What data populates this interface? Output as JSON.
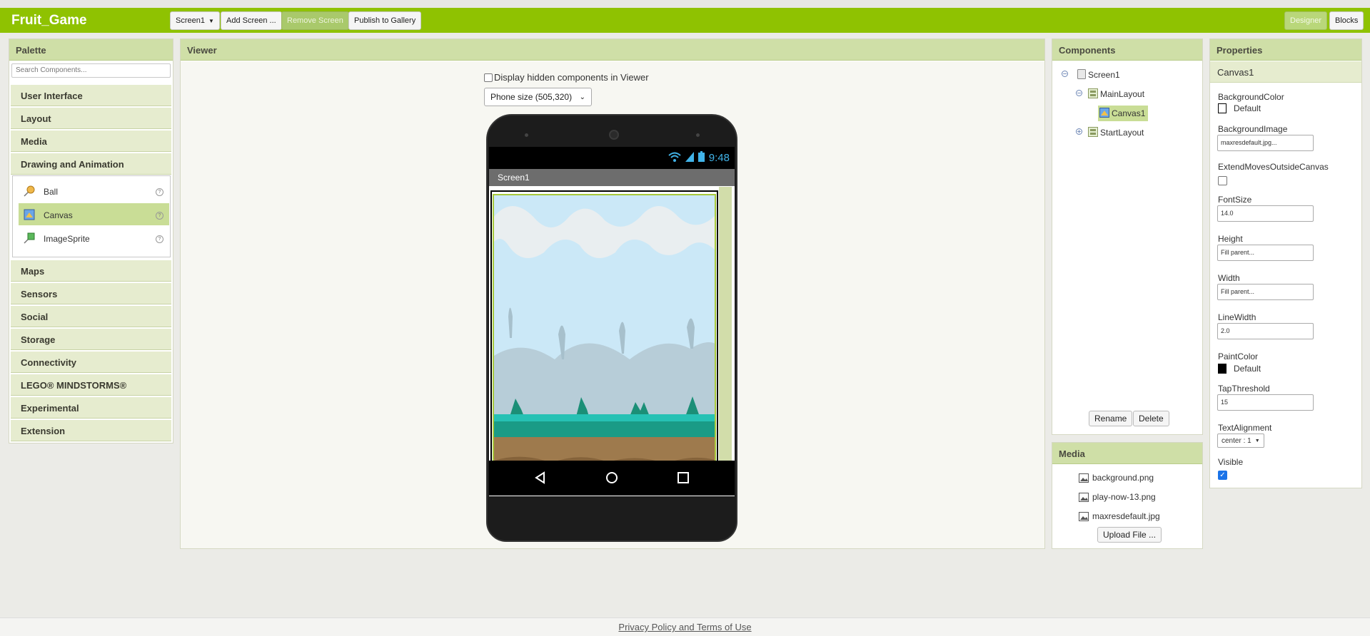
{
  "app": {
    "title": "Fruit_Game"
  },
  "toolbar": {
    "screen_select": "Screen1",
    "add_screen": "Add Screen ...",
    "remove_screen": "Remove Screen",
    "publish": "Publish to Gallery",
    "designer": "Designer",
    "blocks": "Blocks"
  },
  "palette": {
    "title": "Palette",
    "search_placeholder": "Search Components...",
    "categories_top": [
      "User Interface",
      "Layout",
      "Media",
      "Drawing and Animation"
    ],
    "items": [
      {
        "label": "Ball",
        "icon": "ball-icon",
        "help": "?"
      },
      {
        "label": "Canvas",
        "icon": "canvas-icon",
        "help": "?",
        "selected": true
      },
      {
        "label": "ImageSprite",
        "icon": "imagesprite-icon",
        "help": "?"
      }
    ],
    "categories_bottom": [
      "Maps",
      "Sensors",
      "Social",
      "Storage",
      "Connectivity",
      "LEGO® MINDSTORMS®",
      "Experimental",
      "Extension"
    ]
  },
  "viewer": {
    "title": "Viewer",
    "hidden_checkbox_label": "Display hidden components in Viewer",
    "size_select": "Phone size (505,320)",
    "status_time": "9:48",
    "screen_title": "Screen1"
  },
  "components": {
    "title": "Components",
    "tree": [
      {
        "label": "Screen1",
        "toggle": "−"
      },
      {
        "label": "MainLayout",
        "toggle": "−"
      },
      {
        "label": "Canvas1",
        "selected": true
      },
      {
        "label": "StartLayout",
        "toggle": "+"
      }
    ],
    "rename": "Rename",
    "delete": "Delete"
  },
  "media": {
    "title": "Media",
    "files": [
      "background.png",
      "play-now-13.png",
      "maxresdefault.jpg"
    ],
    "upload": "Upload File ..."
  },
  "properties": {
    "title": "Properties",
    "component": "Canvas1",
    "background_color_label": "BackgroundColor",
    "background_color_value": "Default",
    "background_image_label": "BackgroundImage",
    "background_image_value": "maxresdefault.jpg...",
    "extend_label": "ExtendMovesOutsideCanvas",
    "fontsize_label": "FontSize",
    "fontsize_value": "14.0",
    "height_label": "Height",
    "height_value": "Fill parent...",
    "width_label": "Width",
    "width_value": "Fill parent...",
    "linewidth_label": "LineWidth",
    "linewidth_value": "2.0",
    "paintcolor_label": "PaintColor",
    "paintcolor_value": "Default",
    "tapthreshold_label": "TapThreshold",
    "tapthreshold_value": "15",
    "textalignment_label": "TextAlignment",
    "textalignment_value": "center : 1",
    "visible_label": "Visible",
    "visible_checked": true
  },
  "footer": {
    "link": "Privacy Policy and Terms of Use"
  },
  "colors": {
    "brand": "#8fc201",
    "panel_header": "#cfdfa7",
    "selected": "#c9dd96"
  }
}
